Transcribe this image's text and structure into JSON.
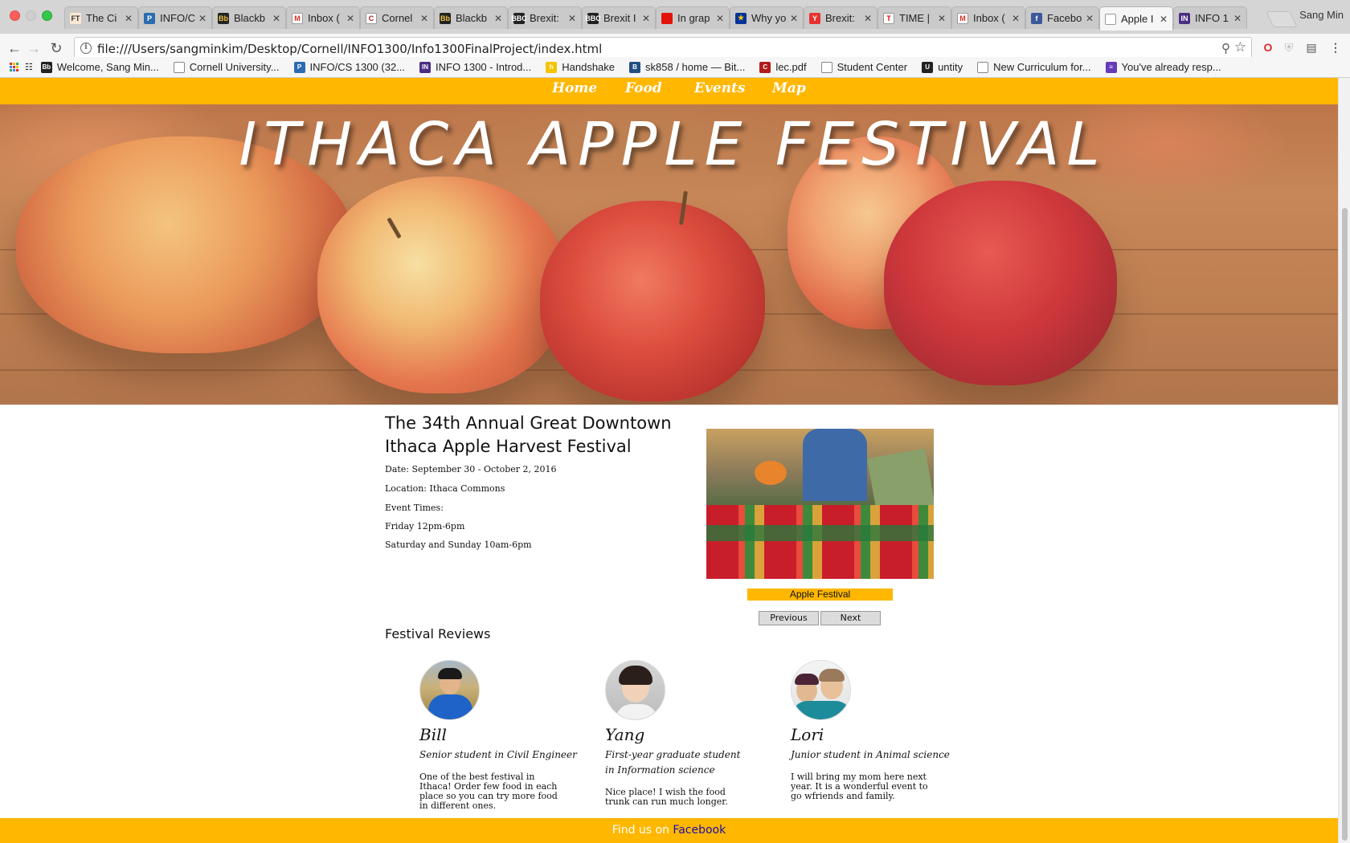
{
  "browser": {
    "tabs": [
      {
        "title": "The Ci",
        "favicon_text": "FT",
        "favicon_color": "#fce8d5",
        "favicon_fg": "#333"
      },
      {
        "title": "INFO/C",
        "favicon_text": "P",
        "favicon_color": "#2b6cb0",
        "favicon_fg": "#fff"
      },
      {
        "title": "Blackb",
        "favicon_text": "Bb",
        "favicon_color": "#222222",
        "favicon_fg": "#f0c040"
      },
      {
        "title": "Inbox (",
        "favicon_text": "M",
        "favicon_color": "#ffffff",
        "favicon_fg": "#d93025"
      },
      {
        "title": "Cornel",
        "favicon_text": "C",
        "favicon_color": "#ffffff",
        "favicon_fg": "#b31b1b"
      },
      {
        "title": "Blackb",
        "favicon_text": "Bb",
        "favicon_color": "#222222",
        "favicon_fg": "#f0c040"
      },
      {
        "title": "Brexit:",
        "favicon_text": "BBC",
        "favicon_color": "#222222",
        "favicon_fg": "#fff"
      },
      {
        "title": "Brexit I",
        "favicon_text": "BBC",
        "favicon_color": "#222222",
        "favicon_fg": "#fff"
      },
      {
        "title": "In grap",
        "favicon_text": "",
        "favicon_color": "#e3120b",
        "favicon_fg": "#fff"
      },
      {
        "title": "Why yo",
        "favicon_text": "★",
        "favicon_color": "#003399",
        "favicon_fg": "#ffcc00"
      },
      {
        "title": "Brexit:",
        "favicon_text": "Y",
        "favicon_color": "#e8312f",
        "favicon_fg": "#fff"
      },
      {
        "title": "TIME |",
        "favicon_text": "T",
        "favicon_color": "#ffffff",
        "favicon_fg": "#e90606"
      },
      {
        "title": "Inbox (",
        "favicon_text": "M",
        "favicon_color": "#ffffff",
        "favicon_fg": "#d93025"
      },
      {
        "title": "Facebo",
        "favicon_text": "f",
        "favicon_color": "#3b5998",
        "favicon_fg": "#fff"
      },
      {
        "title": "Apple I",
        "favicon_text": "",
        "favicon_color": "#ffffff",
        "favicon_fg": "#555",
        "active": true
      },
      {
        "title": "INFO 1",
        "favicon_text": "IN",
        "favicon_color": "#4b2e83",
        "favicon_fg": "#fff"
      }
    ],
    "user_name": "Sang Min",
    "url": "file:///Users/sangminkim/Desktop/Cornell/INFO1300/Info1300FinalProject/index.html",
    "bookmarks": [
      {
        "label": "Welcome, Sang Min...",
        "favicon_text": "Bb",
        "favicon_color": "#222222"
      },
      {
        "label": "Cornell University...",
        "favicon_text": "",
        "favicon_color": "#ffffff"
      },
      {
        "label": "INFO/CS 1300 (32...",
        "favicon_text": "P",
        "favicon_color": "#2b6cb0"
      },
      {
        "label": "INFO 1300 - Introd...",
        "favicon_text": "IN",
        "favicon_color": "#4b2e83"
      },
      {
        "label": "Handshake",
        "favicon_text": "h",
        "favicon_color": "#f5c400"
      },
      {
        "label": "sk858 / home — Bit...",
        "favicon_text": "B",
        "favicon_color": "#205081"
      },
      {
        "label": "lec.pdf",
        "favicon_text": "C",
        "favicon_color": "#b31b1b"
      },
      {
        "label": "Student Center",
        "favicon_text": "",
        "favicon_color": "#ffffff"
      },
      {
        "label": "untity",
        "favicon_text": "U",
        "favicon_color": "#222222"
      },
      {
        "label": "New Curriculum for...",
        "favicon_text": "",
        "favicon_color": "#ffffff"
      },
      {
        "label": "You've already resp...",
        "favicon_text": "≡",
        "favicon_color": "#673ab7"
      }
    ]
  },
  "site": {
    "nav": [
      "Home",
      "Food",
      "Events",
      "Map"
    ],
    "hero_title": "ITHACA APPLE FESTIVAL",
    "intro_title": "The 34th Annual Great Downtown Ithaca Apple Harvest Festival",
    "info_lines": [
      "Date: September 30 - October 2, 2016",
      "Location: Ithaca Commons",
      "Event Times:",
      "Friday 12pm-6pm",
      "Saturday and Sunday 10am-6pm"
    ],
    "slideshow": {
      "caption": "Apple Festival",
      "prev_label": "Previous",
      "next_label": "Next"
    },
    "reviews_title": "Festival Reviews",
    "reviews": [
      {
        "name": "Bill",
        "role": "Senior student in Civil Engineer",
        "text": "One of the best festival in Ithaca! Order few food in each place so you can try more food in different ones."
      },
      {
        "name": "Yang",
        "role": "First-year graduate student in Information science",
        "text": "Nice place! I wish the food trunk can run much longer."
      },
      {
        "name": "Lori",
        "role": "Junior student in Animal science",
        "text": "I will bring my mom here next year. It is a wonderful event to go wfriends and family."
      }
    ],
    "footer": {
      "prefix": "Find us on ",
      "link": "Facebook"
    },
    "colors": {
      "accent": "#ffb700",
      "link": "#1a0dab"
    }
  }
}
